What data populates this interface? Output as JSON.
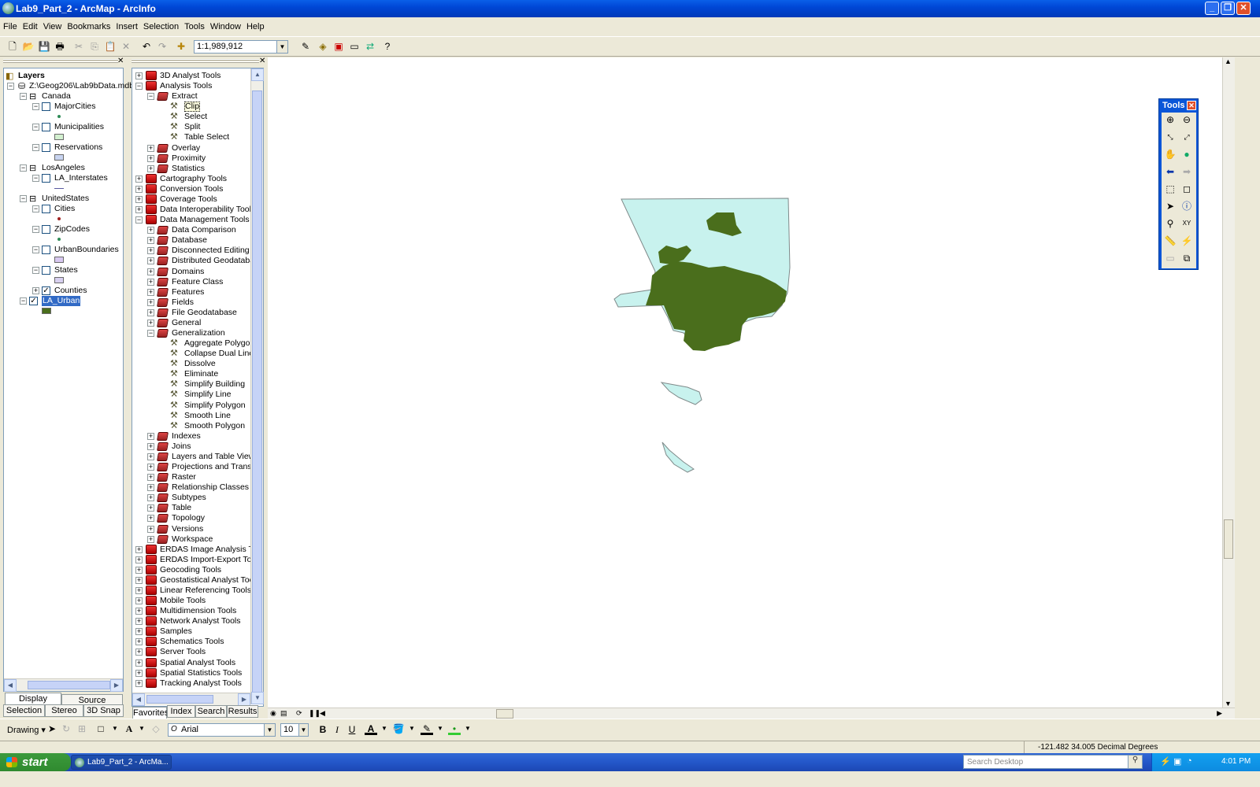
{
  "window": {
    "title": "Lab9_Part_2 - ArcMap - ArcInfo"
  },
  "menu": [
    "File",
    "Edit",
    "View",
    "Bookmarks",
    "Insert",
    "Selection",
    "Tools",
    "Window",
    "Help"
  ],
  "toolbar": {
    "scale": "1:1,989,912"
  },
  "toc": {
    "root": "Layers",
    "db": "Z:\\Geog206\\Lab9bData.mdb",
    "items": [
      {
        "label": "Canada",
        "level": 1,
        "type": "group"
      },
      {
        "label": "MajorCities",
        "level": 2,
        "type": "layer",
        "checked": false,
        "symbol": "point",
        "color": "#2e8b57"
      },
      {
        "label": "Municipalities",
        "level": 2,
        "type": "layer",
        "checked": false,
        "symbol": "poly",
        "color": "#d3f0d0"
      },
      {
        "label": "Reservations",
        "level": 2,
        "type": "layer",
        "checked": false,
        "symbol": "poly",
        "color": "#c8d4f0"
      },
      {
        "label": "LosAngeles",
        "level": 1,
        "type": "group"
      },
      {
        "label": "LA_Interstates",
        "level": 2,
        "type": "layer",
        "checked": false,
        "symbol": "line",
        "color": "#5a5aa0"
      },
      {
        "label": "UnitedStates",
        "level": 1,
        "type": "group"
      },
      {
        "label": "Cities",
        "level": 2,
        "type": "layer",
        "checked": false,
        "symbol": "point",
        "color": "#a02020"
      },
      {
        "label": "ZipCodes",
        "level": 2,
        "type": "layer",
        "checked": false,
        "symbol": "point",
        "color": "#2e8b57"
      },
      {
        "label": "UrbanBoundaries",
        "level": 2,
        "type": "layer",
        "checked": false,
        "symbol": "poly",
        "color": "#d8c8f0"
      },
      {
        "label": "States",
        "level": 2,
        "type": "layer",
        "checked": false,
        "symbol": "poly",
        "color": "#d8d0f0"
      },
      {
        "label": "Counties",
        "level": 2,
        "type": "layer",
        "checked": true,
        "symbol": "none",
        "color": ""
      },
      {
        "label": "LA_Urban",
        "level": 1,
        "type": "layer",
        "checked": true,
        "symbol": "poly",
        "color": "#4a6e1c",
        "selected": true
      }
    ],
    "tabs": {
      "display": "Display",
      "source": "Source",
      "selection": "Selection",
      "stereo": "Stereo",
      "snap": "3D Snap"
    }
  },
  "toolbox": {
    "items": [
      {
        "label": "3D Analyst Tools",
        "level": 0,
        "type": "box",
        "exp": "+"
      },
      {
        "label": "Analysis Tools",
        "level": 0,
        "type": "box",
        "exp": "-"
      },
      {
        "label": "Extract",
        "level": 1,
        "type": "set",
        "exp": "-"
      },
      {
        "label": "Clip",
        "level": 2,
        "type": "tool",
        "selected": true
      },
      {
        "label": "Select",
        "level": 2,
        "type": "tool"
      },
      {
        "label": "Split",
        "level": 2,
        "type": "tool"
      },
      {
        "label": "Table Select",
        "level": 2,
        "type": "tool"
      },
      {
        "label": "Overlay",
        "level": 1,
        "type": "set",
        "exp": "+"
      },
      {
        "label": "Proximity",
        "level": 1,
        "type": "set",
        "exp": "+"
      },
      {
        "label": "Statistics",
        "level": 1,
        "type": "set",
        "exp": "+"
      },
      {
        "label": "Cartography Tools",
        "level": 0,
        "type": "box",
        "exp": "+"
      },
      {
        "label": "Conversion Tools",
        "level": 0,
        "type": "box",
        "exp": "+"
      },
      {
        "label": "Coverage Tools",
        "level": 0,
        "type": "box",
        "exp": "+"
      },
      {
        "label": "Data Interoperability Tools",
        "level": 0,
        "type": "box",
        "exp": "+"
      },
      {
        "label": "Data Management Tools",
        "level": 0,
        "type": "box",
        "exp": "-"
      },
      {
        "label": "Data Comparison",
        "level": 1,
        "type": "set",
        "exp": "+"
      },
      {
        "label": "Database",
        "level": 1,
        "type": "set",
        "exp": "+"
      },
      {
        "label": "Disconnected Editing",
        "level": 1,
        "type": "set",
        "exp": "+"
      },
      {
        "label": "Distributed Geodatabase",
        "level": 1,
        "type": "set",
        "exp": "+"
      },
      {
        "label": "Domains",
        "level": 1,
        "type": "set",
        "exp": "+"
      },
      {
        "label": "Feature Class",
        "level": 1,
        "type": "set",
        "exp": "+"
      },
      {
        "label": "Features",
        "level": 1,
        "type": "set",
        "exp": "+"
      },
      {
        "label": "Fields",
        "level": 1,
        "type": "set",
        "exp": "+"
      },
      {
        "label": "File Geodatabase",
        "level": 1,
        "type": "set",
        "exp": "+"
      },
      {
        "label": "General",
        "level": 1,
        "type": "set",
        "exp": "+"
      },
      {
        "label": "Generalization",
        "level": 1,
        "type": "set",
        "exp": "-"
      },
      {
        "label": "Aggregate Polygons",
        "level": 2,
        "type": "tool"
      },
      {
        "label": "Collapse Dual Lines To",
        "level": 2,
        "type": "tool"
      },
      {
        "label": "Dissolve",
        "level": 2,
        "type": "tool"
      },
      {
        "label": "Eliminate",
        "level": 2,
        "type": "tool"
      },
      {
        "label": "Simplify Building",
        "level": 2,
        "type": "tool"
      },
      {
        "label": "Simplify Line",
        "level": 2,
        "type": "tool"
      },
      {
        "label": "Simplify Polygon",
        "level": 2,
        "type": "tool"
      },
      {
        "label": "Smooth Line",
        "level": 2,
        "type": "tool"
      },
      {
        "label": "Smooth Polygon",
        "level": 2,
        "type": "tool"
      },
      {
        "label": "Indexes",
        "level": 1,
        "type": "set",
        "exp": "+"
      },
      {
        "label": "Joins",
        "level": 1,
        "type": "set",
        "exp": "+"
      },
      {
        "label": "Layers and Table Views",
        "level": 1,
        "type": "set",
        "exp": "+"
      },
      {
        "label": "Projections and Transform",
        "level": 1,
        "type": "set",
        "exp": "+"
      },
      {
        "label": "Raster",
        "level": 1,
        "type": "set",
        "exp": "+"
      },
      {
        "label": "Relationship Classes",
        "level": 1,
        "type": "set",
        "exp": "+"
      },
      {
        "label": "Subtypes",
        "level": 1,
        "type": "set",
        "exp": "+"
      },
      {
        "label": "Table",
        "level": 1,
        "type": "set",
        "exp": "+"
      },
      {
        "label": "Topology",
        "level": 1,
        "type": "set",
        "exp": "+"
      },
      {
        "label": "Versions",
        "level": 1,
        "type": "set",
        "exp": "+"
      },
      {
        "label": "Workspace",
        "level": 1,
        "type": "set",
        "exp": "+"
      },
      {
        "label": "ERDAS Image Analysis Tools",
        "level": 0,
        "type": "box",
        "exp": "+"
      },
      {
        "label": "ERDAS Import-Export Tools",
        "level": 0,
        "type": "box",
        "exp": "+"
      },
      {
        "label": "Geocoding Tools",
        "level": 0,
        "type": "box",
        "exp": "+"
      },
      {
        "label": "Geostatistical Analyst Tools",
        "level": 0,
        "type": "box",
        "exp": "+"
      },
      {
        "label": "Linear Referencing Tools",
        "level": 0,
        "type": "box",
        "exp": "+"
      },
      {
        "label": "Mobile Tools",
        "level": 0,
        "type": "box",
        "exp": "+"
      },
      {
        "label": "Multidimension Tools",
        "level": 0,
        "type": "box",
        "exp": "+"
      },
      {
        "label": "Network Analyst Tools",
        "level": 0,
        "type": "box",
        "exp": "+"
      },
      {
        "label": "Samples",
        "level": 0,
        "type": "box",
        "exp": "+"
      },
      {
        "label": "Schematics Tools",
        "level": 0,
        "type": "box",
        "exp": "+"
      },
      {
        "label": "Server Tools",
        "level": 0,
        "type": "box",
        "exp": "+"
      },
      {
        "label": "Spatial Analyst Tools",
        "level": 0,
        "type": "box",
        "exp": "+"
      },
      {
        "label": "Spatial Statistics Tools",
        "level": 0,
        "type": "box",
        "exp": "+"
      },
      {
        "label": "Tracking Analyst Tools",
        "level": 0,
        "type": "box",
        "exp": "+"
      }
    ],
    "tabs": {
      "favorites": "Favorites",
      "index": "Index",
      "search": "Search",
      "results": "Results"
    }
  },
  "tools_window": {
    "title": "Tools"
  },
  "map": {
    "county_fill": "#c8f2ee",
    "urban_fill": "#4a6e1c"
  },
  "drawing": {
    "label": "Drawing",
    "font": "Arial",
    "size": "10",
    "bold": "B",
    "italic": "I",
    "underline": "U",
    "text": "A"
  },
  "status": {
    "coords": "-121.482  34.005 Decimal Degrees"
  },
  "taskbar": {
    "start": "start",
    "task": "Lab9_Part_2 - ArcMa...",
    "search_placeholder": "Search Desktop",
    "clock": "4:01 PM"
  }
}
